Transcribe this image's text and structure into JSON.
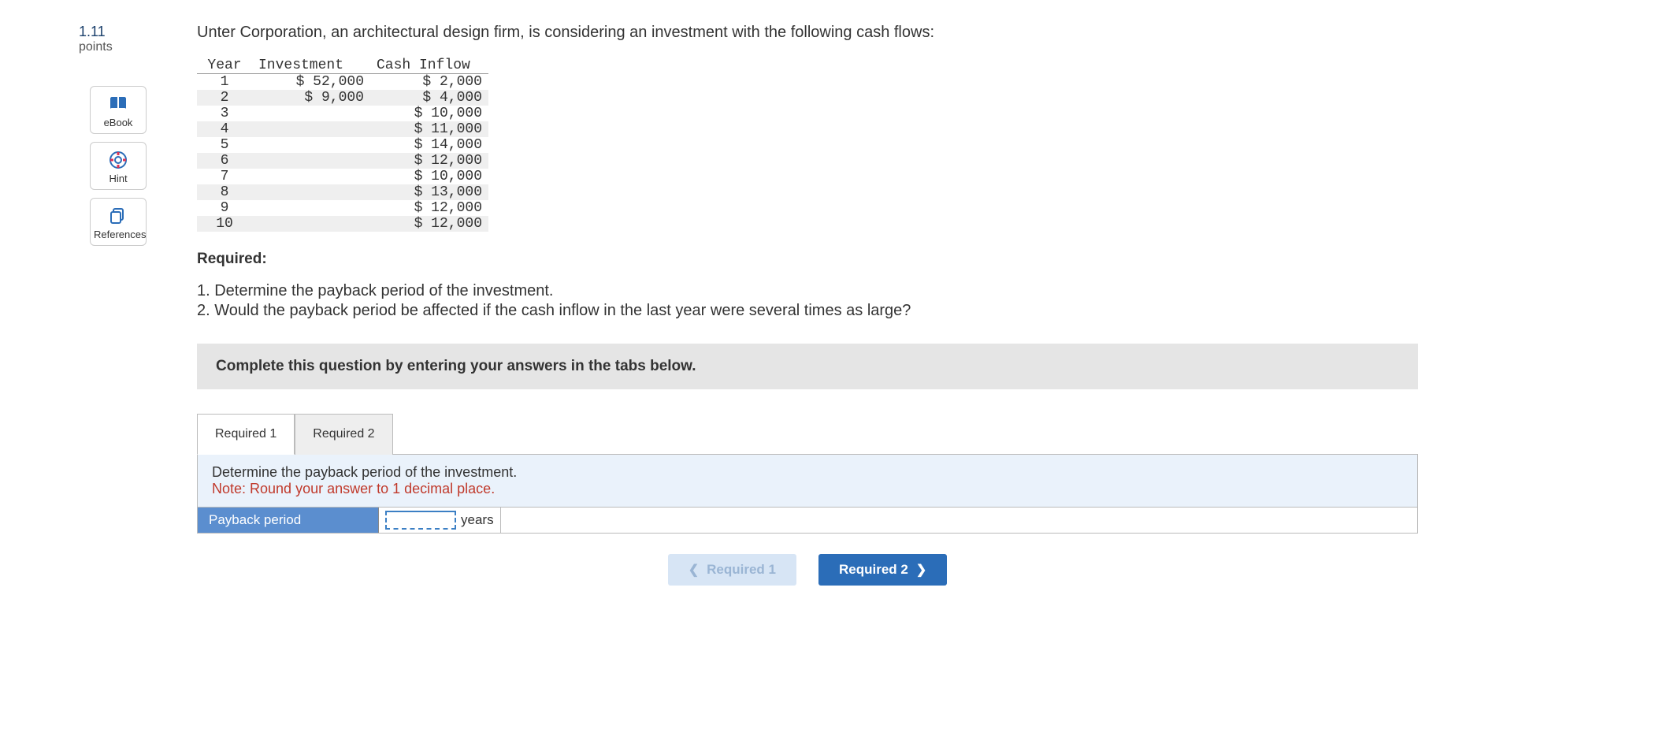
{
  "points": {
    "value": "1.11",
    "label": "points"
  },
  "sidebar": {
    "ebook": "eBook",
    "hint": "Hint",
    "references": "References"
  },
  "problem": {
    "intro": "Unter Corporation, an architectural design firm, is considering an investment with the following cash flows:",
    "table_headers": {
      "year": "Year",
      "investment": "Investment",
      "cash_inflow": "Cash Inflow"
    },
    "rows": [
      {
        "year": "1",
        "investment": "$ 52,000",
        "cash": "$ 2,000"
      },
      {
        "year": "2",
        "investment": "$ 9,000",
        "cash": "$ 4,000"
      },
      {
        "year": "3",
        "investment": "",
        "cash": "$ 10,000"
      },
      {
        "year": "4",
        "investment": "",
        "cash": "$ 11,000"
      },
      {
        "year": "5",
        "investment": "",
        "cash": "$ 14,000"
      },
      {
        "year": "6",
        "investment": "",
        "cash": "$ 12,000"
      },
      {
        "year": "7",
        "investment": "",
        "cash": "$ 10,000"
      },
      {
        "year": "8",
        "investment": "",
        "cash": "$ 13,000"
      },
      {
        "year": "9",
        "investment": "",
        "cash": "$ 12,000"
      },
      {
        "year": "10",
        "investment": "",
        "cash": "$ 12,000"
      }
    ],
    "required_heading": "Required:",
    "requirements": [
      "1.  Determine the payback period of the investment.",
      "2.  Would the payback period be affected if the cash inflow in the last year were several times as large?"
    ]
  },
  "instruction_bar": "Complete this question by entering your answers in the tabs below.",
  "tabs": {
    "tab1": "Required 1",
    "tab2": "Required 2"
  },
  "tab_content": {
    "line1": "Determine the payback period of the investment.",
    "note": "Note: Round your answer to 1 decimal place.",
    "answer_label": "Payback period",
    "answer_value": "",
    "unit": "years"
  },
  "nav": {
    "prev": "Required 1",
    "next": "Required 2"
  }
}
